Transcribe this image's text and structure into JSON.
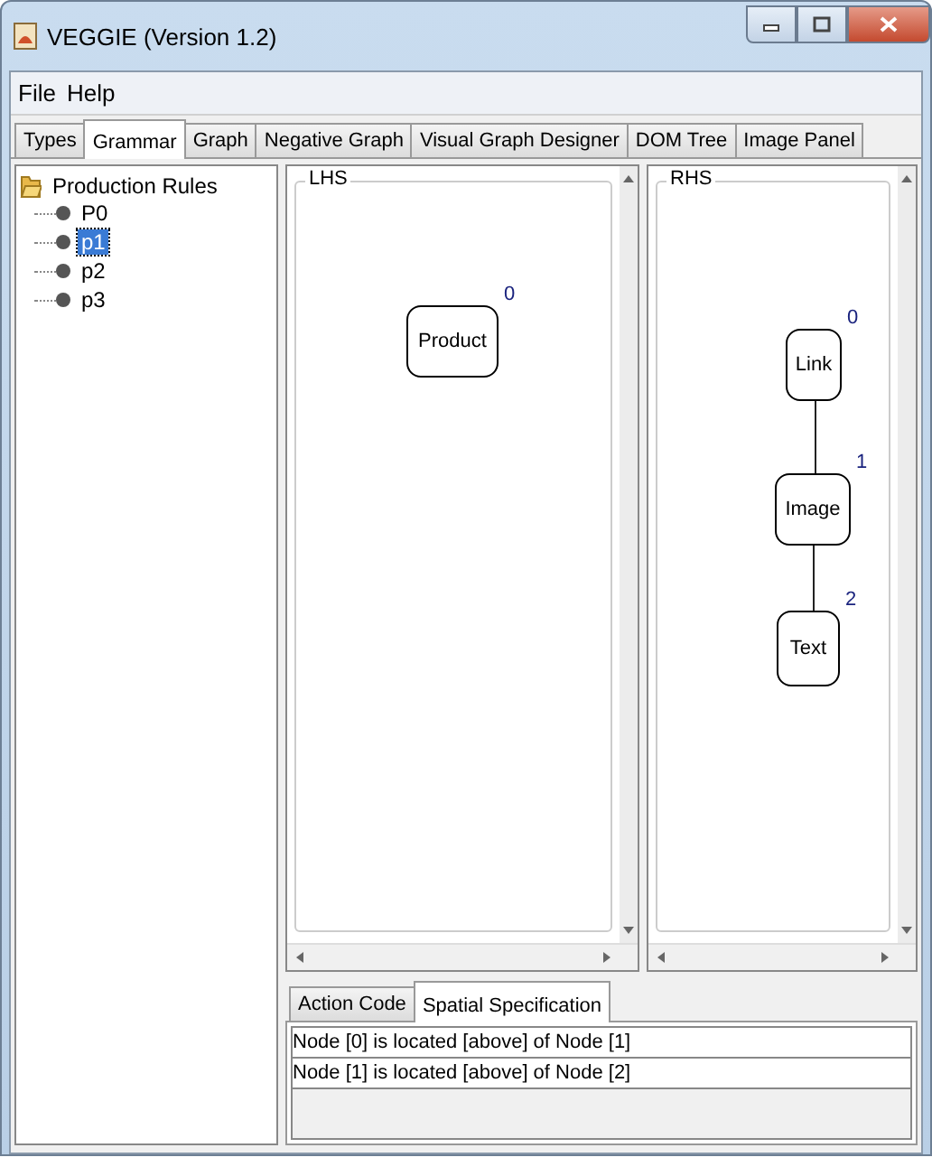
{
  "window": {
    "title": "VEGGIE (Version 1.2)"
  },
  "menu": [
    "File",
    "Help"
  ],
  "tabs": [
    {
      "label": "Types",
      "selected": false
    },
    {
      "label": "Grammar",
      "selected": true
    },
    {
      "label": "Graph",
      "selected": false
    },
    {
      "label": "Negative Graph",
      "selected": false
    },
    {
      "label": "Visual Graph Designer",
      "selected": false
    },
    {
      "label": "DOM Tree",
      "selected": false
    },
    {
      "label": "Image Panel",
      "selected": false
    }
  ],
  "tree": {
    "label": "Production Rules",
    "expanded": true,
    "children": [
      {
        "label": "P0",
        "selected": false
      },
      {
        "label": "p1",
        "selected": true
      },
      {
        "label": "p2",
        "selected": false
      },
      {
        "label": "p3",
        "selected": false
      }
    ]
  },
  "panels": [
    {
      "title": "LHS",
      "nodes": [
        {
          "label": "Product",
          "index": "0"
        }
      ]
    },
    {
      "title": "RHS",
      "nodes": [
        {
          "label": "Link",
          "index": "0",
          "children": [
            {
              "label": "Image",
              "index": "1",
              "children": [
                {
                  "label": "Text",
                  "index": "2"
                }
              ]
            }
          ]
        }
      ]
    }
  ],
  "bottom_tabs": [
    {
      "label": "Action Code",
      "selected": false
    },
    {
      "label": "Spatial Specification",
      "selected": true
    }
  ],
  "specifications": [
    "Node [0] is located [above] of Node [1]",
    "Node [1] is located [above] of Node [2]"
  ]
}
